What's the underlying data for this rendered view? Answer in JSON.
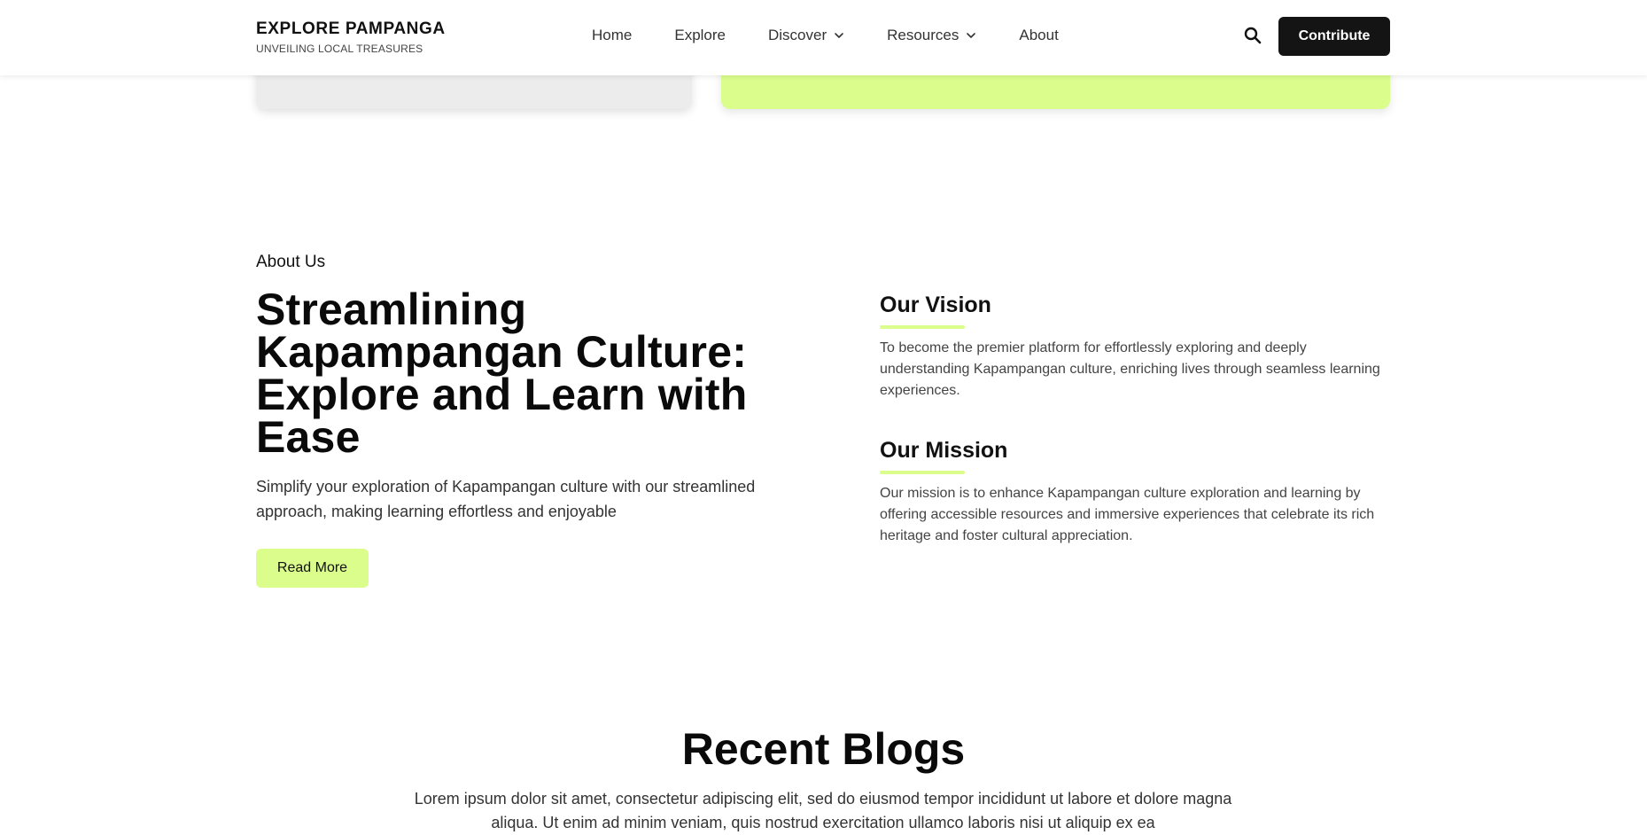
{
  "header": {
    "brand_title": "EXPLORE PAMPANGA",
    "brand_subtitle": "UNVEILING LOCAL TREASURES",
    "nav": [
      {
        "label": "Home",
        "dropdown": false
      },
      {
        "label": "Explore",
        "dropdown": false
      },
      {
        "label": "Discover",
        "dropdown": true
      },
      {
        "label": "Resources",
        "dropdown": true
      },
      {
        "label": "About",
        "dropdown": false
      }
    ],
    "search_icon": "search-icon",
    "contribute_label": "Contribute"
  },
  "colors": {
    "accent_lime": "#dbfd8c",
    "button_dark": "#141414",
    "card_gray": "#ececec"
  },
  "about": {
    "eyebrow": "About Us",
    "heading": "Streamlining Kapampangan Culture: Explore and Learn with Ease",
    "description": "Simplify your exploration of Kapampangan culture with our streamlined approach, making learning effortless and enjoyable",
    "read_more_label": "Read More",
    "vision": {
      "title": "Our Vision",
      "text": "To become the premier platform for effortlessly exploring and deeply understanding Kapampangan culture, enriching lives through seamless learning experiences."
    },
    "mission": {
      "title": "Our Mission",
      "text": "Our mission is to enhance Kapampangan culture exploration and learning by offering accessible resources and immersive experiences that celebrate its rich heritage and foster cultural appreciation."
    }
  },
  "blogs": {
    "title": "Recent Blogs",
    "text": "Lorem ipsum dolor sit amet, consectetur adipiscing elit, sed do eiusmod tempor incididunt ut labore et dolore magna aliqua. Ut enim ad minim veniam, quis nostrud exercitation ullamco laboris nisi ut aliquip ex ea"
  }
}
